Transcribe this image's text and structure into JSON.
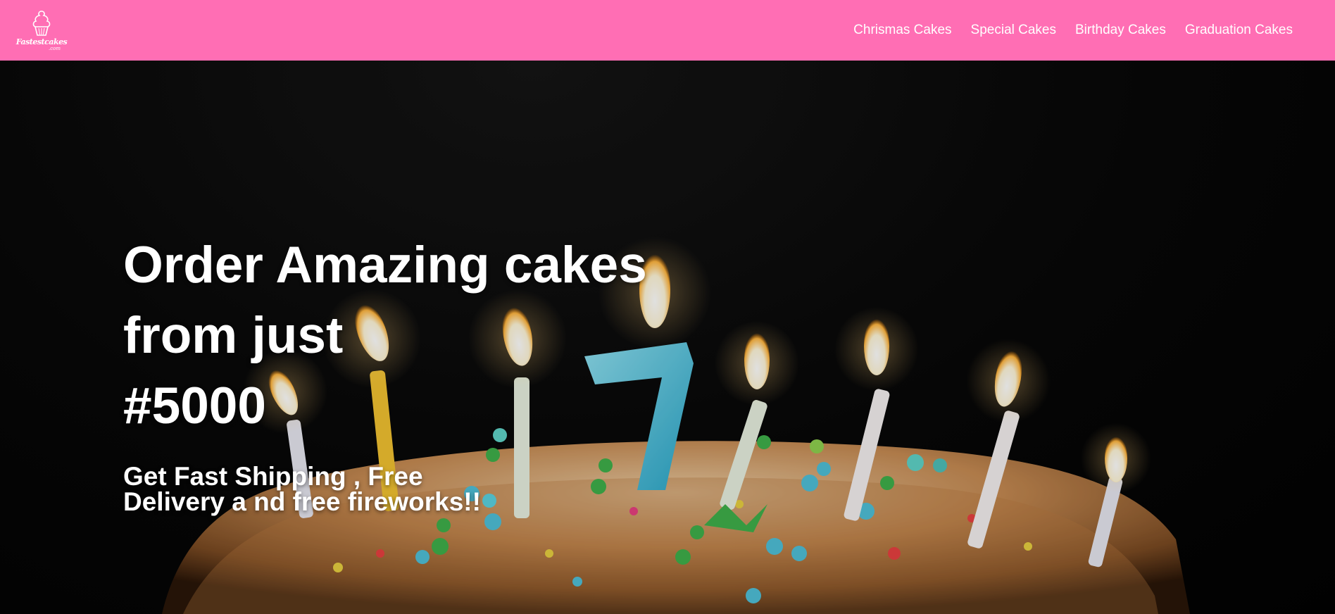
{
  "brand": {
    "logo_text": "Fastestcakes",
    "logo_sub": ".com"
  },
  "nav": {
    "items": [
      {
        "label": "Chrismas Cakes"
      },
      {
        "label": "Special Cakes"
      },
      {
        "label": "Birthday Cakes"
      },
      {
        "label": "Graduation Cakes"
      }
    ]
  },
  "hero": {
    "headline_line1": "Order Amazing cakes",
    "headline_line2": "from just",
    "headline_line3": "#5000",
    "subline": "Get Fast Shipping , Free Delivery a nd free fireworks!!"
  },
  "colors": {
    "navbar": "#ff6eb4",
    "text": "#ffffff"
  }
}
